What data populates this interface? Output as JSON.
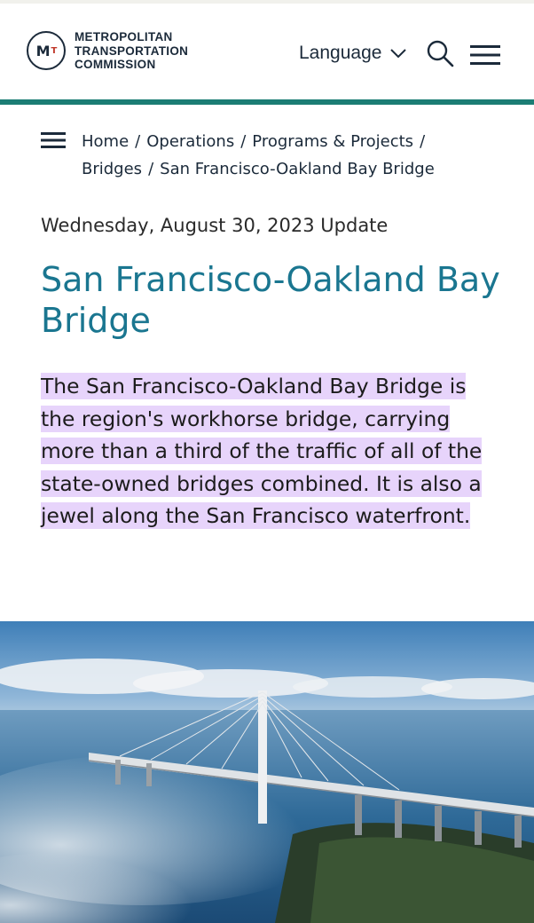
{
  "header": {
    "logo": {
      "mark": "M",
      "mark_accent": "T",
      "lines": [
        "METROPOLITAN",
        "TRANSPORTATION",
        "COMMISSION"
      ]
    },
    "language_label": "Language",
    "icons": {
      "language": "chevron-down-icon",
      "search": "search-icon",
      "menu": "hamburger-menu-icon"
    }
  },
  "breadcrumb": {
    "items": [
      "Home",
      "Operations",
      "Programs & Projects",
      "Bridges",
      "San Francisco-Oakland Bay Bridge"
    ],
    "separator": "/"
  },
  "article": {
    "update_date": "Wednesday, August 30, 2023 Update",
    "title": "San Francisco-Oakland Bay Bridge",
    "intro": "The San Francisco-Oakland Bay Bridge is the region's workhorse bridge, carrying more than a third of the traffic of all of the state-owned bridges combined. It is also a jewel along the San Francisco waterfront."
  },
  "colors": {
    "accent_bar": "#1b7d74",
    "title": "#1a7690",
    "highlight": "#e7d4fb",
    "brand_dark": "#1b2a3a",
    "brand_red": "#c0392b"
  }
}
